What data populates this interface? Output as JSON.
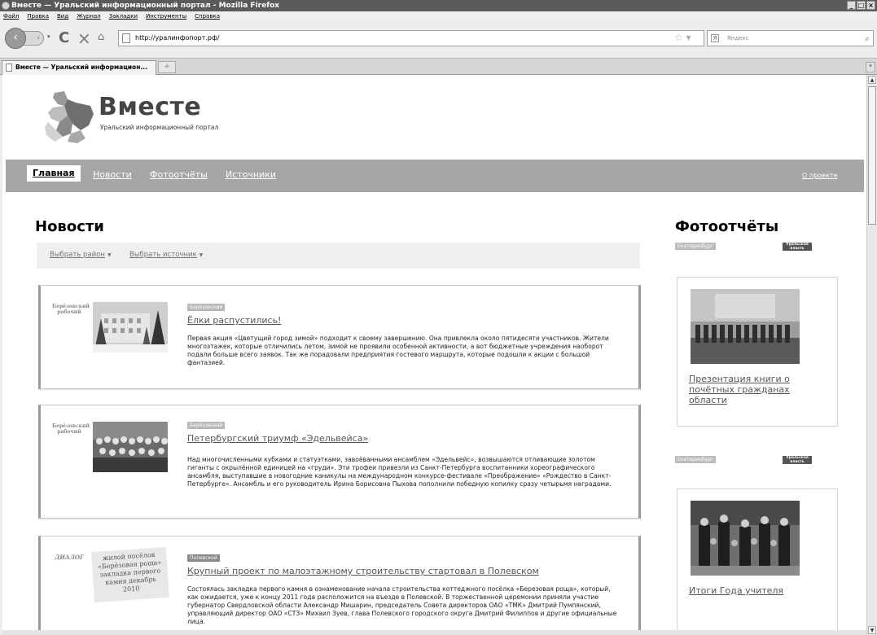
{
  "window": {
    "title": "Вместе — Уральский информационный портал - Mozilla Firefox",
    "buttons": [
      "_",
      "□",
      "×"
    ]
  },
  "menu": [
    "Файл",
    "Правка",
    "Вид",
    "Журнал",
    "Закладки",
    "Инструменты",
    "Справка"
  ],
  "toolbar": {
    "url": "http://уралинфопорт.рф/",
    "search_placeholder": "Яндекс",
    "search_engine_letter": "Я"
  },
  "tab": {
    "label": "Вместе — Уральский информацион...",
    "new_tab": "+"
  },
  "site": {
    "title": "Вместе",
    "subtitle": "Уральский информационный портал",
    "nav": [
      "Главная",
      "Новости",
      "Фотоотчёты",
      "Источники"
    ],
    "about": "О проекте"
  },
  "news": {
    "heading": "Новости",
    "filters": [
      "Выбрать район",
      "Выбрать источник"
    ],
    "items": [
      {
        "source": "Берёзовский рабочий",
        "tag": "Берёзовский",
        "title": "Ёлки распустились!",
        "text": "Первая акция «Цветущий город зимой» подходит к своему завершению. Она привлекла около пятидесяти участников. Жители многоэтажек, которые отличились летом, зимой не проявили особенной активности, а вот бюджетные учреждения наоборот подали больше всего заявок. Так же порадовали предприятия гостевого маршрута, которые подошли к акции с большой фантазией."
      },
      {
        "source": "Берёзовский рабочий",
        "tag": "Берёзовский",
        "title": "Петербургский триумф «Эдельвейса»",
        "text": "Над многочисленными кубками и статуэтками, завоёванными ансамблем «Эдельвейс», возвышаются отливающие золотом гиганты с окрылённой единицей на «груди». Эти трофеи привезли из Санкт-Петербурга воспитанники хореографического ансамбля, выступавшие в новогодние каникулы на международном конкурсе-фестивале «Преображение» «Рождество в Санкт-Петербурге». Ансамбль и его руководитель Ирина Борисовна Пыхова пополнили победную копилку сразу четырьмя наградами."
      },
      {
        "source": "ДИАЛОГ",
        "tag": "Полевской",
        "title": "Крупный проект по малоэтажному строительству стартовал в Полевском",
        "text": "Состоялась закладка первого камня в ознаменование начала строительства коттеджного посёлка «Березовая роща», который, как ожидается, уже к концу 2011 года расположится на въезде в Полевской. В торжественной церемонии приняли участие губернатор Свердловской области Александр Мишарин, председатель Совета директоров ОАО «ТМК» Дмитрий Пумпянский, управляющий директор ОАО «СТЗ» Михаил Зуев, глава Полевского городского округа Дмитрий Филиппов и другие официальные лица.",
        "thumb_text": "жилой посёлок «Берёзовая роща» закладка первого камня декабрь 2010"
      }
    ]
  },
  "photos": {
    "heading": "Фотоотчёты",
    "items": [
      {
        "tag": "Екатеринбург",
        "source": "Уральская власть",
        "title": "Презентация книги о почётных гражданах области"
      },
      {
        "tag": "Екатеринбург",
        "source": "Уральская власть",
        "title": "Итоги Года учителя"
      }
    ]
  }
}
